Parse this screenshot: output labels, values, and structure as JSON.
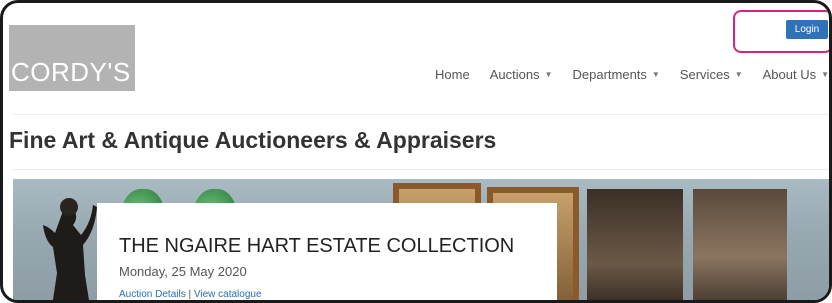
{
  "brand": {
    "logo_text": "CORDY'S",
    "logo_bg": "#b3b3b3"
  },
  "header": {
    "login_label": "Login",
    "login_color": "#2f72b8",
    "highlight_color": "#d4257d"
  },
  "nav": {
    "items": [
      {
        "label": "Home",
        "has_dropdown": false
      },
      {
        "label": "Auctions",
        "has_dropdown": true
      },
      {
        "label": "Departments",
        "has_dropdown": true
      },
      {
        "label": "Services",
        "has_dropdown": true
      },
      {
        "label": "About Us",
        "has_dropdown": true
      }
    ],
    "caret": "▼"
  },
  "tagline": "Fine Art & Antique Auctioneers & Appraisers",
  "featured": {
    "title": "THE NGAIRE HART ESTATE COLLECTION",
    "date": "Monday, 25 May 2020",
    "link_details": "Auction Details",
    "link_separator": "|",
    "link_catalogue": "View catalogue"
  }
}
